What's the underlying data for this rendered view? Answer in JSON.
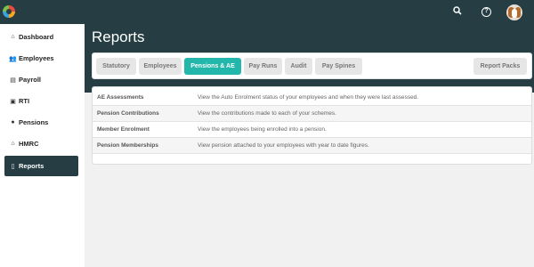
{
  "topbar": {
    "logo": "app-logo",
    "icons": [
      "search-icon",
      "help-icon",
      "avatar"
    ]
  },
  "sidebar": {
    "items": [
      {
        "label": "Dashboard",
        "icon": "home-icon"
      },
      {
        "label": "Employees",
        "icon": "users-icon"
      },
      {
        "label": "Payroll",
        "icon": "payroll-icon"
      },
      {
        "label": "RTI",
        "icon": "document-icon"
      },
      {
        "label": "Pensions",
        "icon": "piggy-bank-icon"
      },
      {
        "label": "HMRC",
        "icon": "bank-icon"
      },
      {
        "label": "Reports",
        "icon": "report-icon",
        "active": true
      }
    ]
  },
  "page": {
    "title": "Reports"
  },
  "tabs": [
    {
      "label": "Statutory"
    },
    {
      "label": "Employees"
    },
    {
      "label": "Pensions & AE",
      "active": true
    },
    {
      "label": "Pay Runs"
    },
    {
      "label": "Audit"
    },
    {
      "label": "Pay Spines"
    },
    {
      "label": "Report Packs"
    }
  ],
  "reports": [
    {
      "name": "AE Assessments",
      "description": "View the Auto Enrolment status of your employees and when they were last assessed."
    },
    {
      "name": "Pension Contributions",
      "description": "View the contributions made to each of your schemes."
    },
    {
      "name": "Member Enrolment",
      "description": "View the employees being enrolled into a pension."
    },
    {
      "name": "Pension Memberships",
      "description": "View pension attached to your employees with year to date figures."
    }
  ],
  "colors": {
    "header": "#263e43",
    "accent": "#22b7aa",
    "background": "#f1f1f1"
  }
}
